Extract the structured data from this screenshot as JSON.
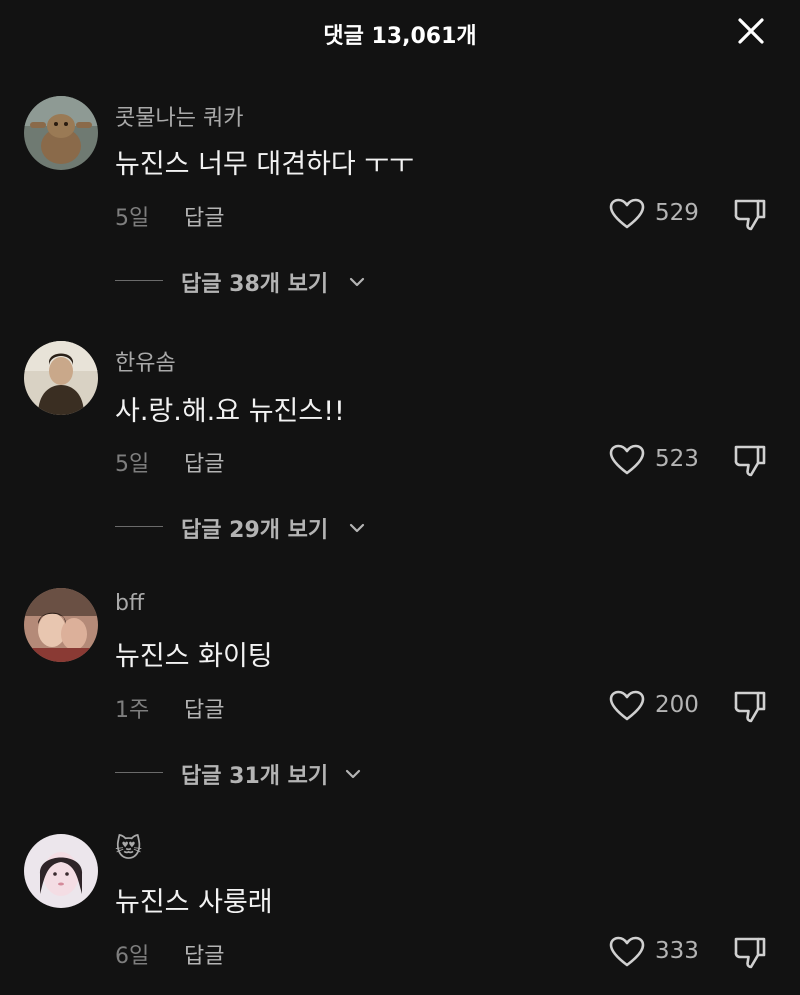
{
  "header": {
    "title": "댓글 13,061개",
    "close_icon": "close-icon"
  },
  "comments": [
    {
      "username": "콧물나는 쿼카",
      "text": "뉴진스 너무 대견하다 ㅜㅜ",
      "time": "5일",
      "reply_label": "답글",
      "likes": "529",
      "replies_label": "답글 38개 보기"
    },
    {
      "username": "한유솜",
      "text": "사.랑.해.요 뉴진스!!",
      "time": "5일",
      "reply_label": "답글",
      "likes": "523",
      "replies_label": "답글 29개 보기"
    },
    {
      "username": "bff",
      "text": "뉴진스 화이팅",
      "time": "1주",
      "reply_label": "답글",
      "likes": "200",
      "replies_label": "답글 31개 보기"
    },
    {
      "username": "😻",
      "text": "뉴진스 사룽래",
      "time": "6일",
      "reply_label": "답글",
      "likes": "333"
    }
  ],
  "icons": {
    "like": "heart-outline-icon",
    "dislike": "thumbs-down-outline-icon",
    "expand": "chevron-down-icon"
  }
}
